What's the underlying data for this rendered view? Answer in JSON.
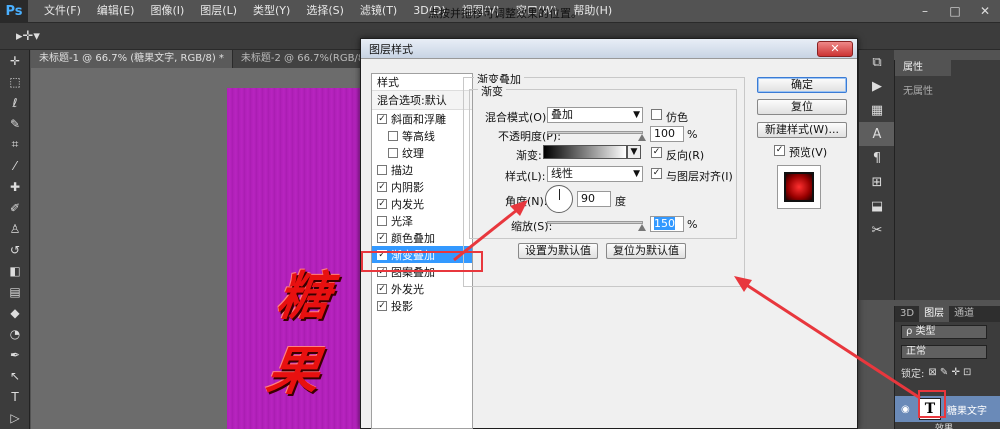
{
  "menu": {
    "logo": "Ps",
    "items": [
      "文件(F)",
      "编辑(E)",
      "图像(I)",
      "图层(L)",
      "类型(Y)",
      "选择(S)",
      "滤镜(T)",
      "3D(D)",
      "视图(V)",
      "窗口(W)",
      "帮助(H)"
    ],
    "minimize": "–",
    "maximize": "□",
    "close": "✕"
  },
  "options": {
    "hint": "点按并拖移可调整效果的位置。"
  },
  "tabs": [
    "未标题-1 @ 66.7% (糖果文字, RGB/8) *",
    "未标题-2 @ 66.7%(RGB/8) *"
  ],
  "canvas": {
    "text": "糖果"
  },
  "dialog": {
    "title": "图层样式",
    "close": "✕",
    "styles_header": "样式",
    "blend_options": "混合选项:默认",
    "styles": [
      {
        "label": "斜面和浮雕",
        "checked": "✓",
        "sub": false
      },
      {
        "label": "等高线",
        "checked": "",
        "sub": true
      },
      {
        "label": "纹理",
        "checked": "",
        "sub": true
      },
      {
        "label": "描边",
        "checked": "",
        "sub": false
      },
      {
        "label": "内阴影",
        "checked": "✓",
        "sub": false
      },
      {
        "label": "内发光",
        "checked": "✓",
        "sub": false
      },
      {
        "label": "光泽",
        "checked": "",
        "sub": false
      },
      {
        "label": "颜色叠加",
        "checked": "✓",
        "sub": false
      },
      {
        "label": "渐变叠加",
        "checked": "✓",
        "sub": false
      },
      {
        "label": "图案叠加",
        "checked": "✓",
        "sub": false
      },
      {
        "label": "外发光",
        "checked": "✓",
        "sub": false
      },
      {
        "label": "投影",
        "checked": "✓",
        "sub": false
      }
    ],
    "group_title": "渐变叠加",
    "sub_title": "渐变",
    "blend_mode_label": "混合模式(O):",
    "blend_mode_value": "叠加",
    "dither_label": "仿色",
    "opacity_label": "不透明度(P):",
    "opacity_value": "100",
    "opacity_fraction": 1.0,
    "percent": "%",
    "gradient_label": "渐变:",
    "reverse_label": "反向(R)",
    "reverse_checked": "✓",
    "style_label": "样式(L):",
    "style_value": "线性",
    "align_label": "与图层对齐(I)",
    "align_checked": "✓",
    "angle_label": "角度(N):",
    "angle_value": "90",
    "angle_unit": "度",
    "scale_label": "缩放(S):",
    "scale_value": "150",
    "scale_fraction": 1.0,
    "set_default": "设置为默认值",
    "reset_default": "复位为默认值",
    "ok": "确定",
    "reset": "复位",
    "new_style": "新建样式(W)...",
    "preview_label": "预览(V)",
    "preview_checked": "✓"
  },
  "panels": {
    "properties_tab": "属性",
    "no_properties": "无属性",
    "tab_3d": "3D",
    "tab_layers": "图层",
    "tab_channels": "通道",
    "kind_filter": "ρ 类型",
    "blend_mode": "正常",
    "lock_label": "锁定:",
    "layer_name": "糖果文字",
    "layer_thumb": "T",
    "effects_label": "效果"
  },
  "colors": {
    "annotation": "#e8373d",
    "selection": "#3399ff",
    "canvas": "#b020b8"
  }
}
